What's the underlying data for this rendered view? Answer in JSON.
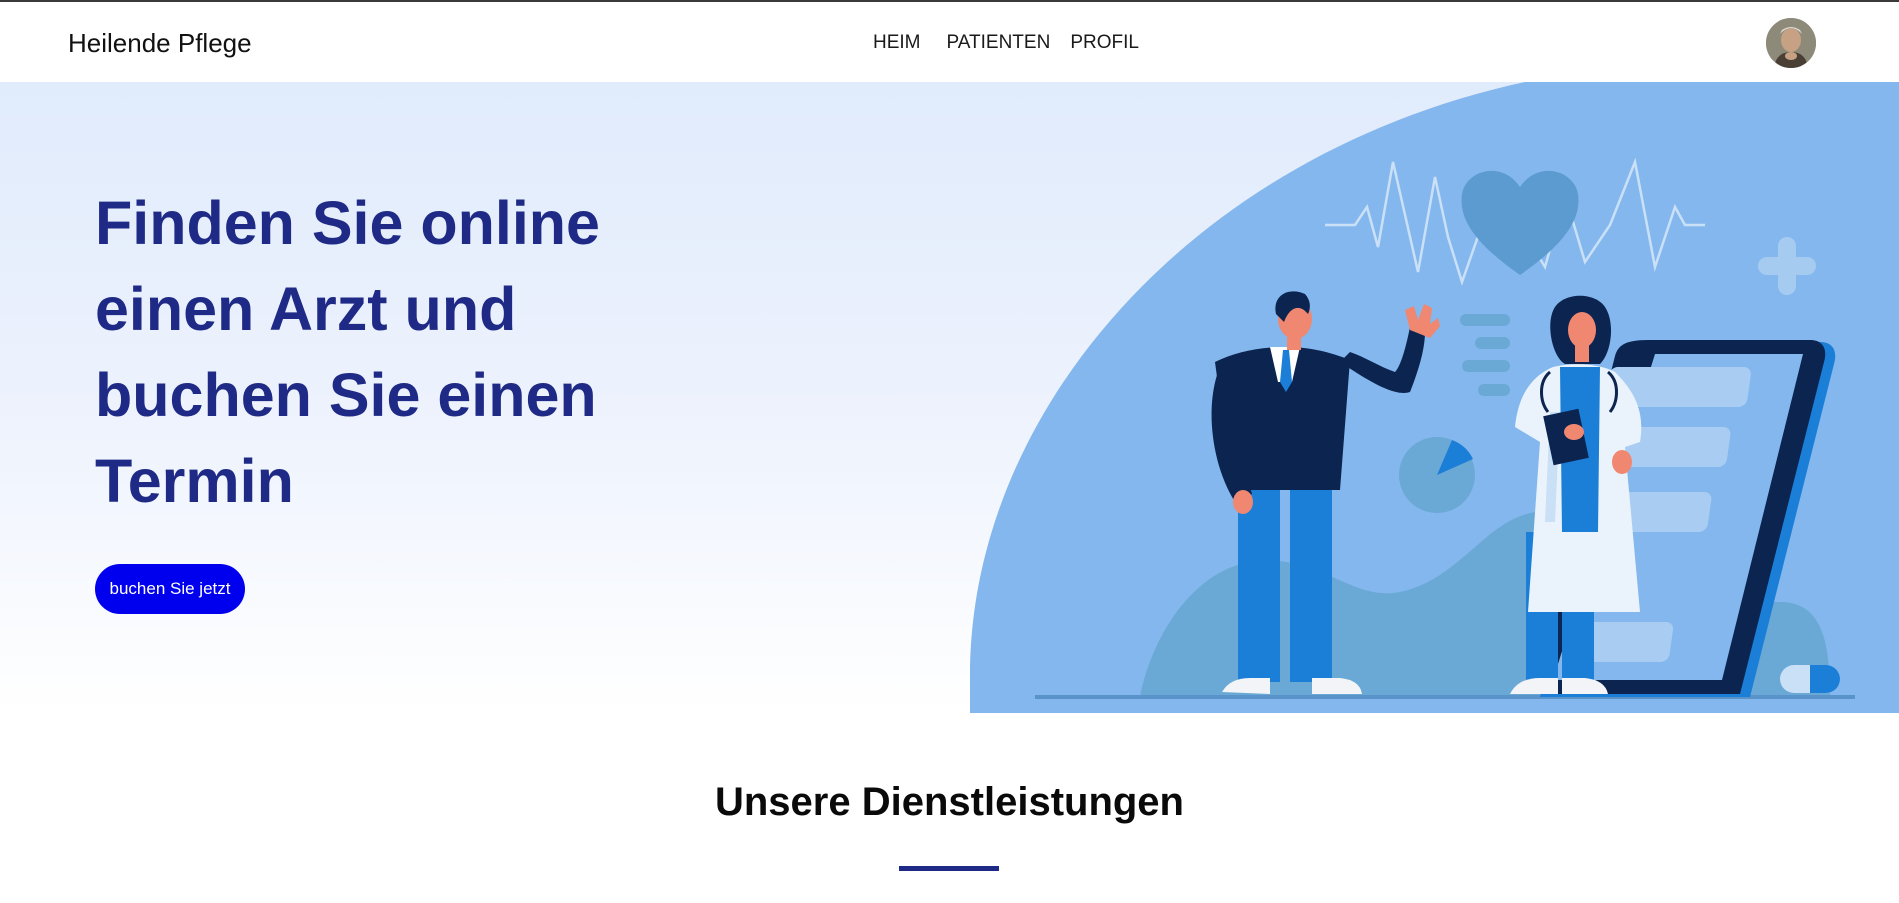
{
  "brand": {
    "name": "Heilende Pflege"
  },
  "nav": {
    "items": [
      {
        "label": "HEIM"
      },
      {
        "label": "PATIENTEN"
      },
      {
        "label": "PROFIL"
      }
    ]
  },
  "hero": {
    "title": "Finden Sie online einen Arzt und buchen Sie einen Termin",
    "cta_label": "buchen Sie jetzt",
    "illustration": "doctors-illustration"
  },
  "services": {
    "title": "Unsere Dienstleistungen"
  },
  "colors": {
    "title_blue": "#1e2a85",
    "button_blue": "#0000ee",
    "illustration_bg": "#84b7ed",
    "hero_bg_top": "#e0ebfc"
  },
  "icons": [
    "user-avatar",
    "heartbeat-icon",
    "heart-icon",
    "plus-icon",
    "pie-chart-icon",
    "pill-icon"
  ]
}
